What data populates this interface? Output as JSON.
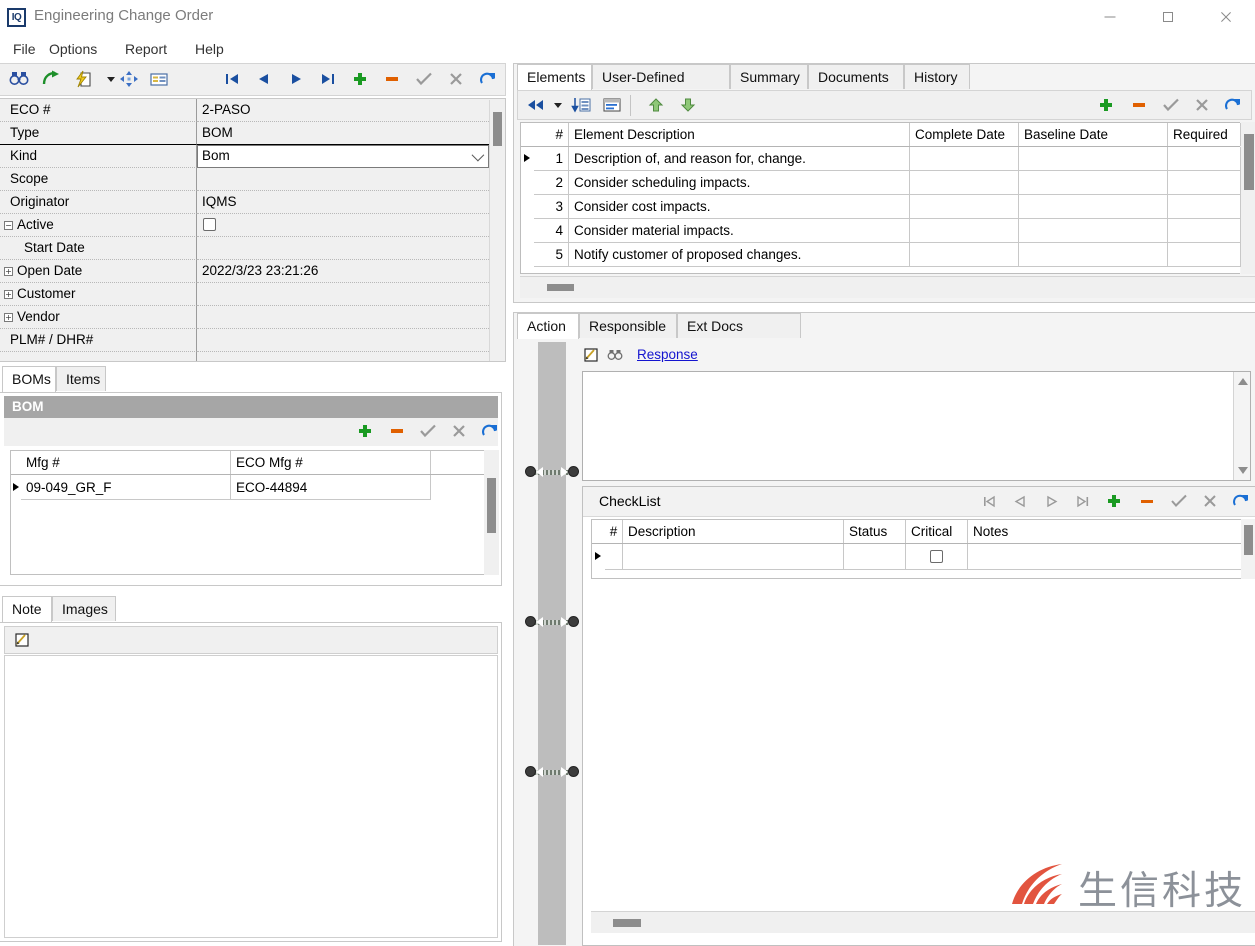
{
  "window": {
    "title": "Engineering Change Order",
    "logo_text": "IQ",
    "controls": {
      "minimize": "minimize-button",
      "maximize": "maximize-button",
      "close": "close-button"
    }
  },
  "menubar": {
    "items": [
      "File",
      "Options",
      "Report",
      "Help"
    ]
  },
  "left_toolbar": {
    "icons": [
      "find-icon",
      "forward-arrow-icon",
      "lightning-page-icon",
      "dropdown-arrow-icon",
      "move-icon",
      "form-view-icon"
    ],
    "nav": [
      "first-record-icon",
      "previous-record-icon",
      "next-record-icon",
      "last-record-icon"
    ],
    "actions": [
      "add-icon",
      "delete-icon",
      "post-icon",
      "cancel-icon",
      "refresh-icon"
    ]
  },
  "form": {
    "rows": [
      {
        "label": "ECO #",
        "value": "2-PASO",
        "type": "text"
      },
      {
        "label": "Type",
        "value": "BOM",
        "type": "text"
      },
      {
        "label": "Kind",
        "value": "Bom",
        "type": "combo"
      },
      {
        "label": "Scope",
        "value": "",
        "type": "text"
      },
      {
        "label": "Originator",
        "value": "IQMS",
        "type": "text"
      },
      {
        "label": "Active",
        "value": "",
        "type": "checkbox",
        "expander": "minus"
      },
      {
        "label": "Start Date",
        "value": "",
        "type": "text",
        "indent": true
      },
      {
        "label": "Open Date",
        "value": "2022/3/23 23:21:26",
        "type": "text",
        "expander": "plus"
      },
      {
        "label": "Customer",
        "value": "",
        "type": "text",
        "expander": "plus"
      },
      {
        "label": "Vendor",
        "value": "",
        "type": "text",
        "expander": "plus"
      },
      {
        "label": "PLM# / DHR#",
        "value": "",
        "type": "text"
      }
    ]
  },
  "bom_section": {
    "tabs": [
      {
        "label": "BOMs",
        "active": true
      },
      {
        "label": "Items",
        "active": false
      }
    ],
    "header": "BOM",
    "toolbar_actions": [
      "add-icon",
      "delete-icon",
      "post-icon",
      "cancel-icon",
      "refresh-icon"
    ],
    "columns": [
      "Mfg #",
      "ECO Mfg #"
    ],
    "rows": [
      {
        "mfg": "09-049_GR_F",
        "eco_mfg": "ECO-44894",
        "selected": true
      }
    ]
  },
  "note_section": {
    "tabs": [
      {
        "label": "Note",
        "active": true
      },
      {
        "label": "Images",
        "active": false
      }
    ],
    "toolbar_icons": [
      "note-edit-icon"
    ],
    "content": ""
  },
  "elements_panel": {
    "tabs": [
      {
        "label": "Elements",
        "active": true
      },
      {
        "label": "User-Defined Form",
        "active": false
      },
      {
        "label": "Summary",
        "active": false
      },
      {
        "label": "Documents",
        "active": false
      },
      {
        "label": "History",
        "active": false
      }
    ],
    "toolbar": {
      "left_icons": [
        "rewind-icon",
        "dropdown-arrow-icon",
        "sort-descending-icon",
        "grid-layout-icon"
      ],
      "move_icons": [
        "move-up-icon",
        "move-down-icon"
      ],
      "right_icons": [
        "add-icon",
        "delete-icon",
        "post-icon",
        "cancel-icon",
        "refresh-icon"
      ]
    },
    "columns": [
      "#",
      "Element Description",
      "Complete Date",
      "Baseline Date",
      "Required"
    ],
    "rows": [
      {
        "num": "1",
        "description": "Description of, and reason for, change.",
        "complete_date": "",
        "baseline_date": "",
        "required": "",
        "selected": true
      },
      {
        "num": "2",
        "description": "Consider scheduling impacts.",
        "complete_date": "",
        "baseline_date": "",
        "required": "",
        "selected": false
      },
      {
        "num": "3",
        "description": "Consider cost impacts.",
        "complete_date": "",
        "baseline_date": "",
        "required": "",
        "selected": false
      },
      {
        "num": "4",
        "description": "Consider material impacts.",
        "complete_date": "",
        "baseline_date": "",
        "required": "",
        "selected": false
      },
      {
        "num": "5",
        "description": "Notify customer of proposed changes.",
        "complete_date": "",
        "baseline_date": "",
        "required": "",
        "selected": false
      }
    ]
  },
  "action_panel": {
    "tabs": [
      {
        "label": "Action",
        "active": true
      },
      {
        "label": "Responsible",
        "active": false
      },
      {
        "label": "Ext Docs Element",
        "active": false
      }
    ],
    "response": {
      "label": "Response",
      "icons": [
        "note-edit-icon",
        "find-icon"
      ],
      "value": ""
    },
    "checklist": {
      "title": "CheckList",
      "nav_icons": [
        "first-record-icon",
        "previous-record-icon",
        "next-record-icon",
        "last-record-icon"
      ],
      "action_icons": [
        "add-icon",
        "delete-icon",
        "post-icon",
        "cancel-icon",
        "refresh-icon"
      ],
      "columns": [
        "#",
        "Description",
        "Status",
        "Critical",
        "Notes"
      ],
      "rows": [
        {
          "num": "",
          "description": "",
          "status": "",
          "critical": false,
          "notes": "",
          "selected": true
        }
      ]
    }
  },
  "watermark": {
    "text": "生信科技"
  },
  "colors": {
    "accent_blue": "#1414cf",
    "add_green": "#1a9a22",
    "delete_orange": "#e06000",
    "refresh_blue": "#1a6fd4",
    "header_gray": "#a6a6a6",
    "watermark_red": "#e2543f",
    "watermark_gray": "#8c9199"
  }
}
